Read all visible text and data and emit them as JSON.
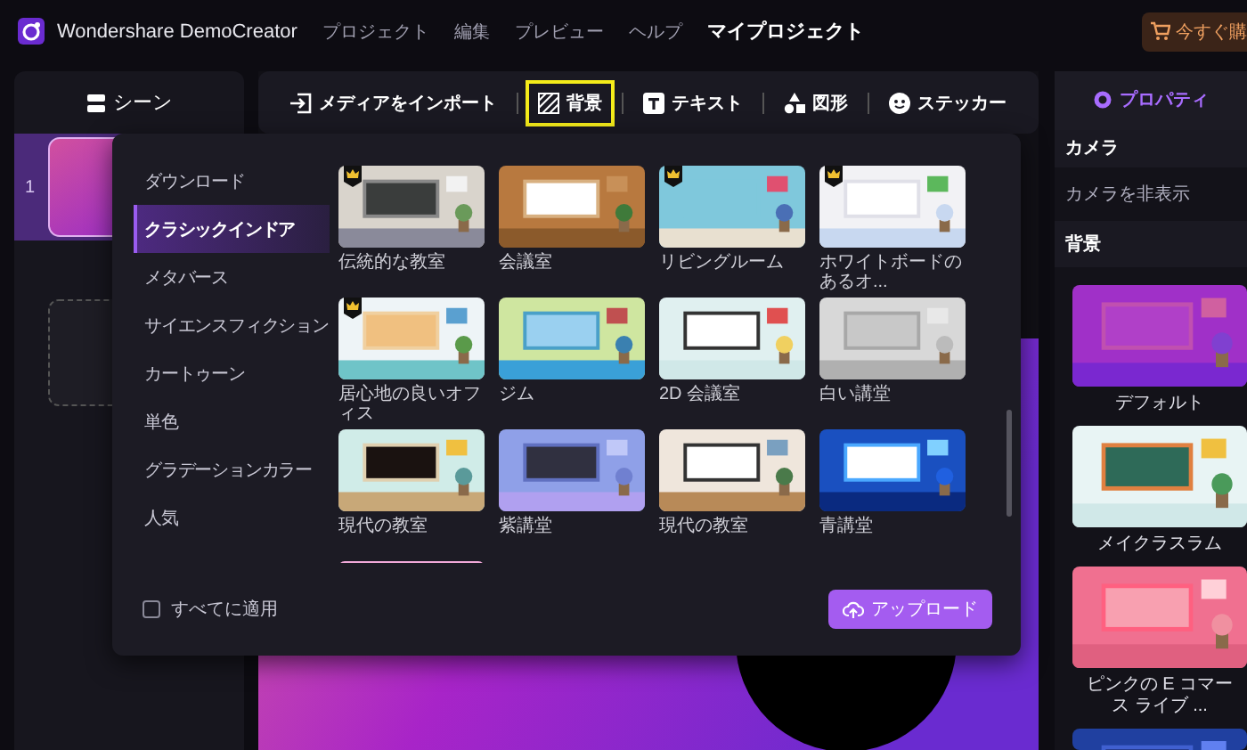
{
  "app": {
    "name": "Wondershare DemoCreator",
    "menu": [
      "プロジェクト",
      "編集",
      "プレビュー",
      "ヘルプ"
    ],
    "title": "マイプロジェクト",
    "buy_button": "今すぐ購"
  },
  "scenes": {
    "title": "シーン",
    "items": [
      {
        "number": "1",
        "selected": true
      }
    ]
  },
  "toolbar": [
    {
      "kind": "import",
      "label": "メディアをインポート",
      "selected": false
    },
    {
      "kind": "background",
      "label": "背景",
      "selected": true
    },
    {
      "kind": "text",
      "label": "テキスト",
      "selected": false
    },
    {
      "kind": "shapes",
      "label": "図形",
      "selected": false
    },
    {
      "kind": "sticker",
      "label": "ステッカー",
      "selected": false
    }
  ],
  "background_popup": {
    "categories": [
      {
        "label": "ダウンロード",
        "selected": false
      },
      {
        "label": "クラシックインドア",
        "selected": true
      },
      {
        "label": "メタバース",
        "selected": false
      },
      {
        "label": "サイエンスフィクション",
        "selected": false
      },
      {
        "label": "カートゥーン",
        "selected": false
      },
      {
        "label": "単色",
        "selected": false
      },
      {
        "label": "グラデーションカラー",
        "selected": false
      },
      {
        "label": "人気",
        "selected": false
      }
    ],
    "items": [
      {
        "label": "伝統的な教室",
        "premium": true
      },
      {
        "label": "会議室",
        "premium": false
      },
      {
        "label": "リビングルーム",
        "premium": true
      },
      {
        "label": "ホワイトボードのあるオ...",
        "premium": true
      },
      {
        "label": "居心地の良いオフィス",
        "premium": true
      },
      {
        "label": "ジム",
        "premium": false
      },
      {
        "label": "2D 会議室",
        "premium": false
      },
      {
        "label": "白い講堂",
        "premium": false
      },
      {
        "label": "現代の教室",
        "premium": false
      },
      {
        "label": "紫講堂",
        "premium": false
      },
      {
        "label": "現代の教室",
        "premium": false
      },
      {
        "label": "青講堂",
        "premium": false
      },
      {
        "kind": "picture",
        "premium": false
      }
    ],
    "apply_all": {
      "label": "すべてに適用",
      "checked": false
    },
    "upload_button": "アップロード"
  },
  "properties": {
    "tab": "プロパティ",
    "camera": {
      "title": "カメラ",
      "option": "カメラを非表示"
    },
    "background": {
      "title": "背景",
      "items": [
        {
          "label": "デフォルト"
        },
        {
          "label": "メイクラスラム"
        },
        {
          "label": "ピンクの E コマース ライブ ..."
        },
        {
          "kind": "picture"
        }
      ]
    }
  }
}
